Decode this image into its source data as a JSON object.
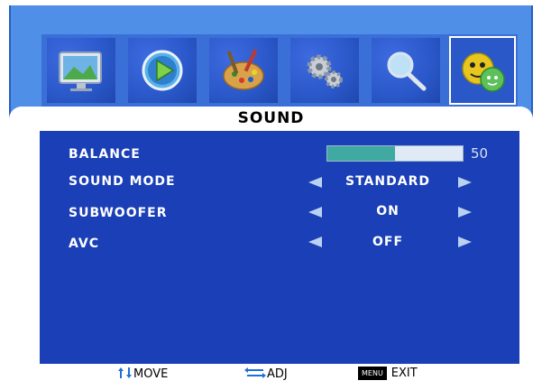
{
  "menu": {
    "title": "SOUND",
    "tabs": [
      {
        "name": "picture",
        "icon": "monitor-icon"
      },
      {
        "name": "playback",
        "icon": "play-icon"
      },
      {
        "name": "color",
        "icon": "palette-icon"
      },
      {
        "name": "setup",
        "icon": "gears-icon"
      },
      {
        "name": "search",
        "icon": "magnifier-icon"
      },
      {
        "name": "sound",
        "icon": "sound-face-icon",
        "active": true
      }
    ]
  },
  "rows": {
    "balance": {
      "label": "BALANCE",
      "value": "50",
      "level": 0.5
    },
    "sound_mode": {
      "label": "SOUND MODE",
      "value": "STANDARD"
    },
    "subwoofer": {
      "label": "SUBWOOFER",
      "value": "ON"
    },
    "avc": {
      "label": "AVC",
      "value": "OFF"
    }
  },
  "footer": {
    "move": "MOVE",
    "adj": "ADJ",
    "menu_key": "MENU",
    "exit": "EXIT"
  },
  "colors": {
    "frame": "#4f8fe8",
    "content_bg": "#1a3fb6",
    "bar_fill": "#3fa9a2",
    "arrow": "#b9d2f2"
  }
}
